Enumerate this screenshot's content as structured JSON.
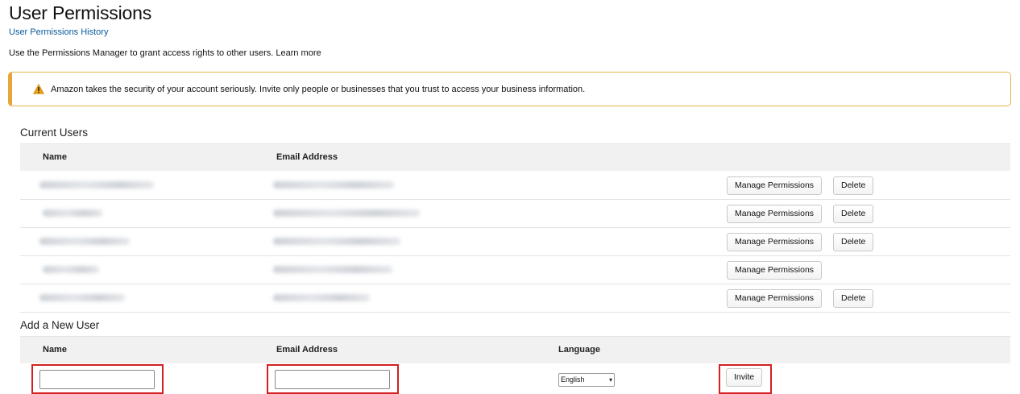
{
  "header": {
    "title": "User Permissions",
    "history_link": "User Permissions History",
    "intro": "Use the Permissions Manager to grant access rights to other users. Learn more"
  },
  "alert": {
    "icon": "warning-icon",
    "text": "Amazon takes the security of your account seriously. Invite only people or businesses that you trust to access your business information.",
    "border_color": "#e8a53a"
  },
  "current_users": {
    "title": "Current Users",
    "columns": {
      "name": "Name",
      "email": "Email Address"
    },
    "manage_label": "Manage Permissions",
    "delete_label": "Delete",
    "rows": [
      {
        "has_delete": true
      },
      {
        "has_delete": true
      },
      {
        "has_delete": true
      },
      {
        "has_delete": false
      },
      {
        "has_delete": true
      }
    ]
  },
  "add_user": {
    "title": "Add a New User",
    "columns": {
      "name": "Name",
      "email": "Email Address",
      "language": "Language"
    },
    "name_value": "",
    "email_value": "",
    "language_selected": "English",
    "invite_label": "Invite",
    "highlight_color": "#d42020"
  }
}
